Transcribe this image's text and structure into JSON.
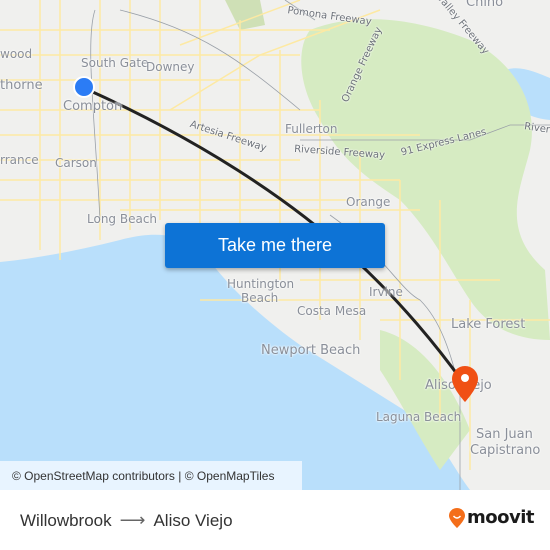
{
  "map": {
    "labels": [
      {
        "text": "wood",
        "size": "normal"
      },
      {
        "text": "thorne",
        "size": "big"
      },
      {
        "text": "South Gate",
        "size": "normal"
      },
      {
        "text": "Downey",
        "size": "normal"
      },
      {
        "text": "Compton",
        "size": "big"
      },
      {
        "text": "Carson",
        "size": "normal"
      },
      {
        "text": "rrance",
        "size": "normal"
      },
      {
        "text": "Long Beach",
        "size": "normal"
      },
      {
        "text": "Fullerton",
        "size": "normal"
      },
      {
        "text": "Orange",
        "size": "normal"
      },
      {
        "text": "Huntington",
        "size": "normal"
      },
      {
        "text": "Beach",
        "size": "normal"
      },
      {
        "text": "Costa Mesa",
        "size": "normal"
      },
      {
        "text": "Irvine",
        "size": "normal"
      },
      {
        "text": "Newport Beach",
        "size": "big"
      },
      {
        "text": "Lake Forest",
        "size": "big"
      },
      {
        "text": "Aliso Viejo",
        "size": "big"
      },
      {
        "text": "Laguna Beach",
        "size": "normal"
      },
      {
        "text": "San Juan",
        "size": "big"
      },
      {
        "text": "Capistrano",
        "size": "big"
      },
      {
        "text": "Chino",
        "size": "big"
      }
    ],
    "roads": [
      {
        "text": "Pomona Freeway"
      },
      {
        "text": "Orange Freeway"
      },
      {
        "text": "Valley Freeway"
      },
      {
        "text": "Artesia Freeway"
      },
      {
        "text": "Riverside Freeway"
      },
      {
        "text": "91 Express Lanes"
      },
      {
        "text": "River"
      }
    ],
    "colors": {
      "water": "#b9dffb",
      "land": "#f0f0ee",
      "park": "#cfe6b6",
      "road": "#fde9a3",
      "route_line": "#222222",
      "origin": "#2b7cf5",
      "destination": "#f05014"
    }
  },
  "cta": {
    "label": "Take me there"
  },
  "attribution": "© OpenStreetMap contributors | © OpenMapTiles",
  "footer": {
    "origin": "Willowbrook",
    "arrow": "⟶",
    "destination": "Aliso Viejo",
    "brand": "moovit",
    "brand_color": "#f46e1a"
  }
}
